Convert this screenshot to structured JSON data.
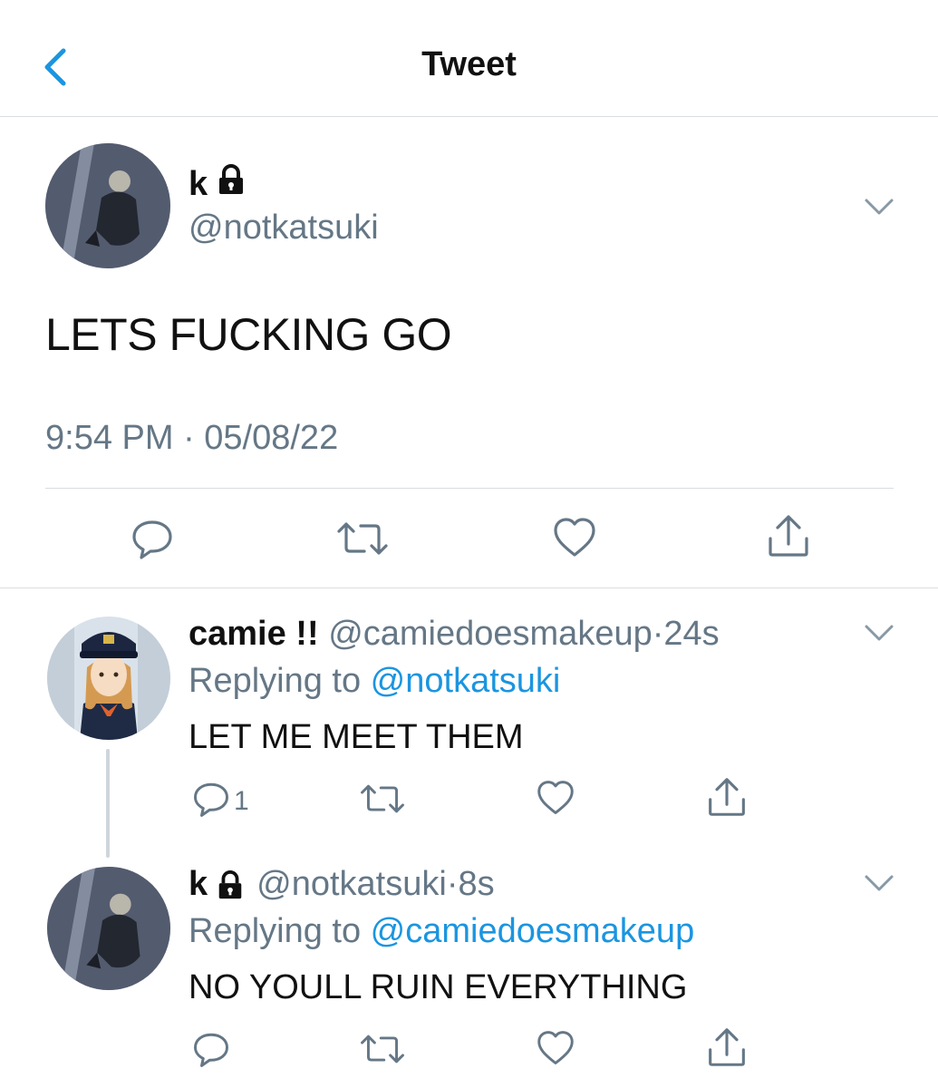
{
  "header": {
    "title": "Tweet"
  },
  "main_tweet": {
    "name": "k",
    "handle": "@notkatsuki",
    "text": "LETS FUCKING GO",
    "timestamp": "9:54 PM · 05/08/22"
  },
  "replies": [
    {
      "name": "camie !!",
      "handle": "@camiedoesmakeup",
      "time": "24s",
      "replying_label": "Replying to ",
      "replying_to": "@notkatsuki",
      "text": "LET ME MEET THEM",
      "reply_count": "1"
    },
    {
      "name": "k",
      "handle": "@notkatsuki",
      "time": "8s",
      "replying_label": "Replying to ",
      "replying_to": "@camiedoesmakeup",
      "text": "NO YOULL RUIN EVERYTHING"
    }
  ],
  "separator": "·",
  "colors": {
    "link": "#1b95e0",
    "secondary": "#657786",
    "icon": "#657786",
    "divider": "#d9dde0"
  }
}
